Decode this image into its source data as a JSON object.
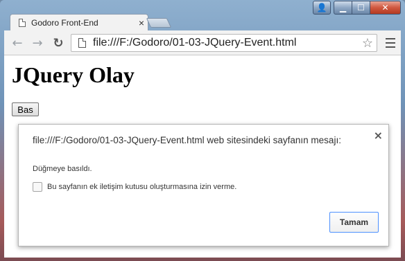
{
  "window": {
    "tab_title": "Godoro Front-End",
    "tab_close": "×",
    "caption": {
      "user": "👤",
      "minimize": "▁",
      "maximize": "☐",
      "close": "✕"
    }
  },
  "toolbar": {
    "back": "←",
    "forward": "→",
    "reload": "↻",
    "url": "file:///F:/Godoro/01-03-JQuery-Event.html",
    "star": "☆"
  },
  "page": {
    "heading": "JQuery Olay",
    "button_label": "Bas"
  },
  "dialog": {
    "title": "file:///F:/Godoro/01-03-JQuery-Event.html web sitesindeki sayfanın mesajı:",
    "message": "Düğmeye basıldı.",
    "checkbox_label": "Bu sayfanın ek iletişim kutusu oluşturmasına izin verme.",
    "ok_label": "Tamam",
    "close": "×"
  },
  "colors": {
    "focus_blue": "#4d90fe",
    "close_red": "#c7442a"
  }
}
